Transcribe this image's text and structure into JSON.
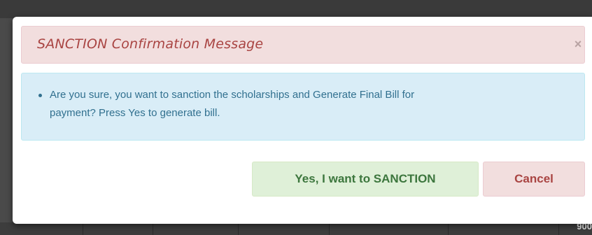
{
  "background": {
    "partial_number": "900"
  },
  "modal": {
    "title": "SANCTION Confirmation Message",
    "close_label": "×",
    "messages": [
      {
        "line1": "Are you sure, you want to sanction the scholarships and Generate Final Bill for",
        "line2": "payment? Press Yes to generate bill."
      }
    ],
    "buttons": {
      "confirm_label": "Yes, I want to SANCTION",
      "cancel_label": "Cancel"
    }
  },
  "colors": {
    "header_bg": "#f2dede",
    "header_text": "#a94442",
    "info_bg": "#d9edf7",
    "info_text": "#31708f",
    "success_bg": "#dff0d8",
    "success_text": "#3c763d"
  }
}
